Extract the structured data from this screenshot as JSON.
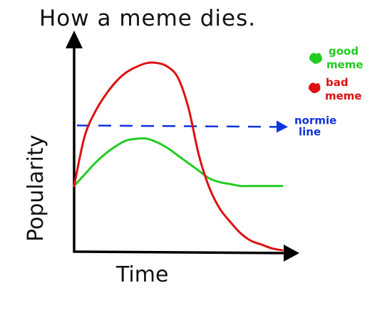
{
  "chart_data": {
    "type": "line",
    "title": "How a meme dies.",
    "xlabel": "Time",
    "ylabel": "Popularity",
    "ylim": [
      0,
      100
    ],
    "xlim": [
      0,
      100
    ],
    "grid": false,
    "legend_position": "top-right",
    "x": [
      0,
      5,
      10,
      15,
      20,
      25,
      30,
      35,
      40,
      45,
      50,
      55,
      60,
      65,
      70,
      75,
      80,
      85,
      90,
      95,
      100
    ],
    "series": [
      {
        "name": "good meme",
        "color": "#22cc22",
        "values": [
          34,
          40,
          46,
          51,
          55,
          58,
          59,
          59,
          57,
          54,
          50,
          46,
          42,
          38,
          36,
          35,
          34,
          34,
          34,
          34,
          34
        ]
      },
      {
        "name": "bad meme",
        "color": "#dd1111",
        "values": [
          34,
          60,
          73,
          82,
          89,
          94,
          97,
          99,
          99,
          97,
          91,
          75,
          50,
          33,
          22,
          15,
          9,
          5,
          3,
          1,
          0
        ]
      }
    ],
    "reference_line": {
      "label_line1": "normie",
      "label_line2": "line",
      "value": 66,
      "color": "#1133dd",
      "style": "dashed"
    },
    "legend": [
      {
        "label_line1": "good",
        "label_line2": "meme",
        "color": "#22cc22"
      },
      {
        "label_line1": "bad",
        "label_line2": "meme",
        "color": "#dd1111"
      }
    ]
  }
}
